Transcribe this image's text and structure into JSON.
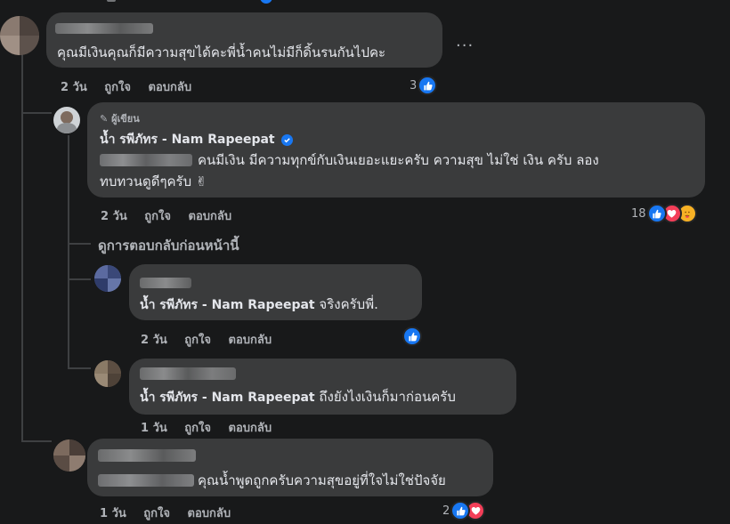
{
  "colors": {
    "like": "#1877f2",
    "love": "#f33e58",
    "haha": "#f7b125",
    "bg": "#18191a",
    "bubble": "#3a3b3c",
    "muted": "#b0b3b8"
  },
  "comment1": {
    "text": "คุณมีเงินคุณก็มีความสุขได้คะพี่น้ำคนไม่มีก็ดิ้นรนกันไปคะ",
    "time": "2 วัน",
    "like": "ถูกใจ",
    "reply": "ตอบกลับ",
    "reactions": "3",
    "more": "..."
  },
  "reply1": {
    "badge": "ผู้เขียน",
    "author": "น้ำ รพีภัทร - Nam Rapeepat",
    "text_line1": "คนมีเงิน มีความทุกข์กับเงินเยอะแยะครับ ความสุข ไม่ใช่ เงิน ครับ ลอง",
    "text_line2": "ทบทวนดูดีๆครับ ✌",
    "time": "2 วัน",
    "like": "ถูกใจ",
    "reply": "ตอบกลับ",
    "reactions": "18"
  },
  "see_previous": "ดูการตอบกลับก่อนหน้านี้",
  "reply2": {
    "mention": "น้ำ รพีภัทร - Nam Rapeepat",
    "text": "จริงครับพี่.",
    "time": "2 วัน",
    "like": "ถูกใจ",
    "reply": "ตอบกลับ"
  },
  "reply3": {
    "mention": "น้ำ รพีภัทร - Nam Rapeepat",
    "text": "ถึงยังไงเงินก็มาก่อนครับ",
    "time": "1 วัน",
    "like": "ถูกใจ",
    "reply": "ตอบกลับ"
  },
  "comment2": {
    "text": "คุณน้ำพูดถูกครับความสุขอยู่ที่ใจไม่ใช่ปัจจัย",
    "time": "1 วัน",
    "like": "ถูกใจ",
    "reply": "ตอบกลับ",
    "reactions": "2"
  }
}
